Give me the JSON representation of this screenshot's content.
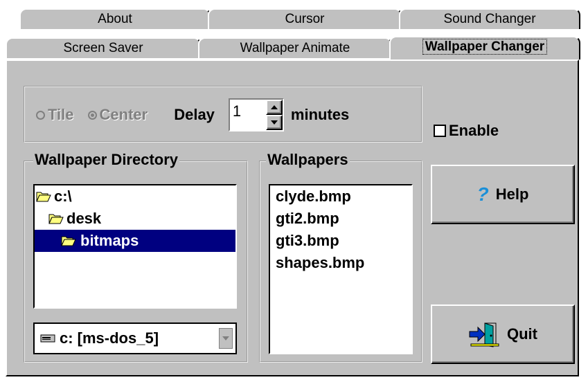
{
  "tabs": {
    "row1": [
      "About",
      "Cursor",
      "Sound Changer"
    ],
    "row2": [
      "Screen Saver",
      "Wallpaper Animate",
      "Wallpaper Changer"
    ],
    "active": "Wallpaper Changer"
  },
  "options": {
    "tile_label": "Tile",
    "center_label": "Center",
    "selected_mode": "Center",
    "delay_label": "Delay",
    "delay_value": "1",
    "minutes_label": "minutes",
    "enable_label": "Enable",
    "enable_checked": false
  },
  "directory": {
    "title": "Wallpaper Directory",
    "items": [
      {
        "label": "c:\\",
        "icon": "folder-open-icon",
        "selected": false
      },
      {
        "label": "desk",
        "icon": "folder-open-icon",
        "selected": false
      },
      {
        "label": "bitmaps",
        "icon": "folder-open-icon",
        "selected": true
      }
    ],
    "drive": "c: [ms-dos_5]"
  },
  "wallpapers": {
    "title": "Wallpapers",
    "files": [
      "clyde.bmp",
      "gti2.bmp",
      "gti3.bmp",
      "shapes.bmp"
    ]
  },
  "buttons": {
    "help": "Help",
    "quit": "Quit"
  },
  "colors": {
    "face": "#c0c0c0",
    "selection": "#000080",
    "help_icon": "#1a8fd8"
  }
}
